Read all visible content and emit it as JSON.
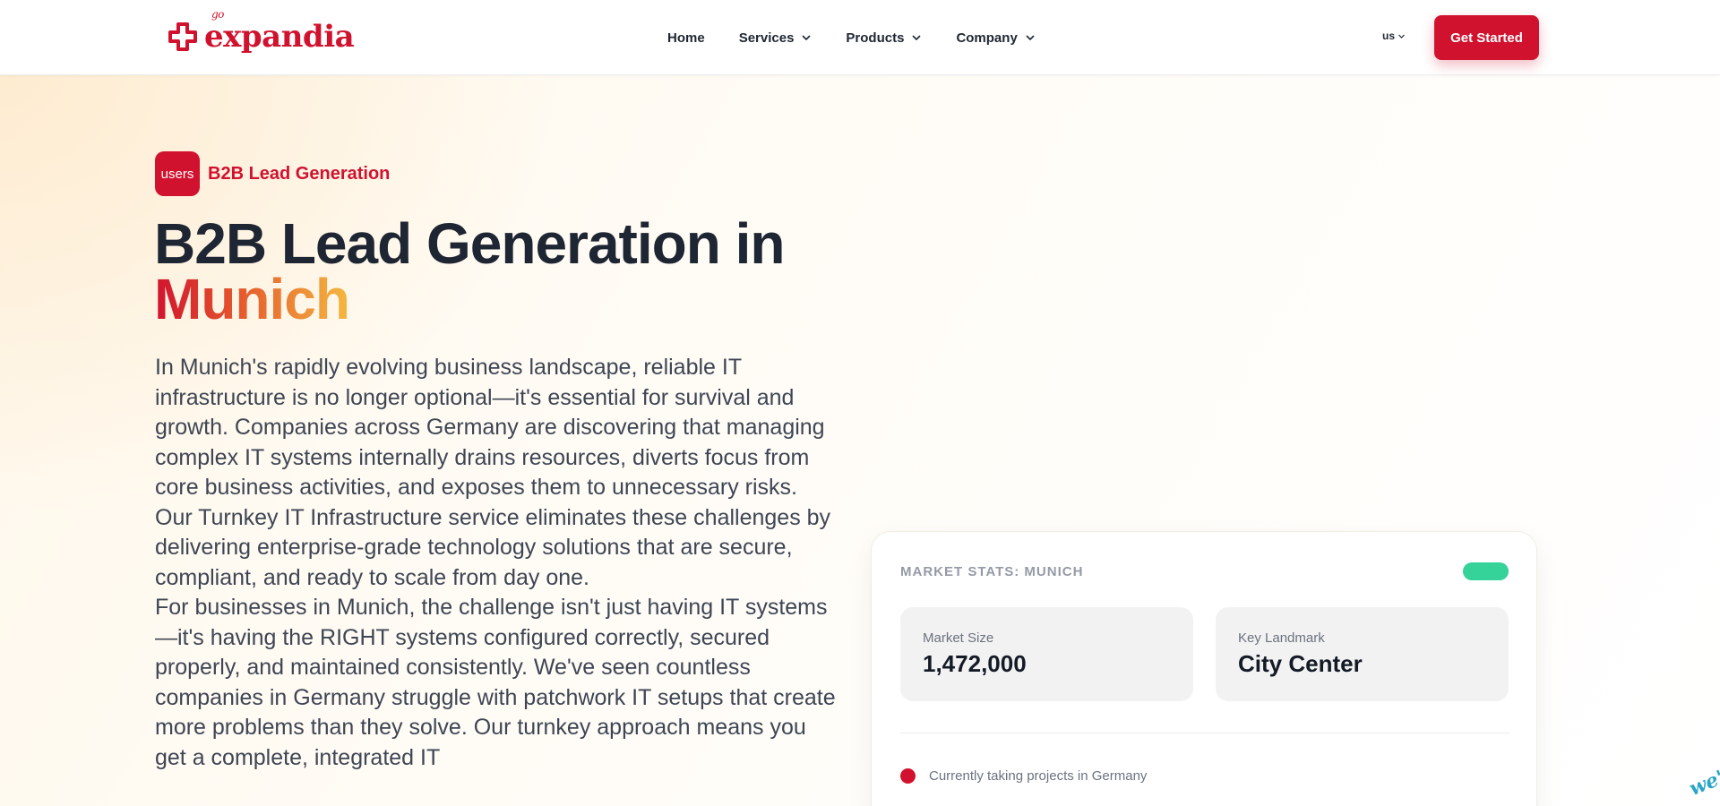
{
  "brand": {
    "name": "expandia",
    "sup": "go",
    "color": "#d1122f"
  },
  "nav": {
    "items": [
      {
        "label": "Home",
        "has_dropdown": false
      },
      {
        "label": "Services",
        "has_dropdown": true
      },
      {
        "label": "Products",
        "has_dropdown": true
      },
      {
        "label": "Company",
        "has_dropdown": true
      }
    ],
    "language": "us",
    "cta_label": "Get Started"
  },
  "hero": {
    "badge_icon": "users",
    "badge_label": "B2B Lead Generation",
    "title_main": "B2B Lead Generation in",
    "title_accent": "Munich",
    "paragraphs": [
      "In Munich's rapidly evolving business landscape, reliable IT infrastructure is no longer optional—it's essential for survival and growth. Companies across Germany are discovering that managing complex IT systems internally drains resources, diverts focus from core business activities, and exposes them to unnecessary risks. Our Turnkey IT Infrastructure service eliminates these challenges by delivering enterprise-grade technology solutions that are secure, compliant, and ready to scale from day one.",
      "For businesses in Munich, the challenge isn't just having IT systems—it's having the RIGHT systems configured correctly, secured properly, and maintained consistently. We've seen countless companies in Germany struggle with patchwork IT setups that create more problems than they solve. Our turnkey approach means you get a complete, integrated IT"
    ]
  },
  "market_card": {
    "title": "MARKET STATS: MUNICH",
    "pill_color": "#35d29a",
    "stats": [
      {
        "label": "Market Size",
        "value": "1,472,000"
      },
      {
        "label": "Key Landmark",
        "value": "City Center"
      }
    ],
    "status_text": "Currently taking projects in Germany"
  },
  "corner_widget_text": "we're He"
}
